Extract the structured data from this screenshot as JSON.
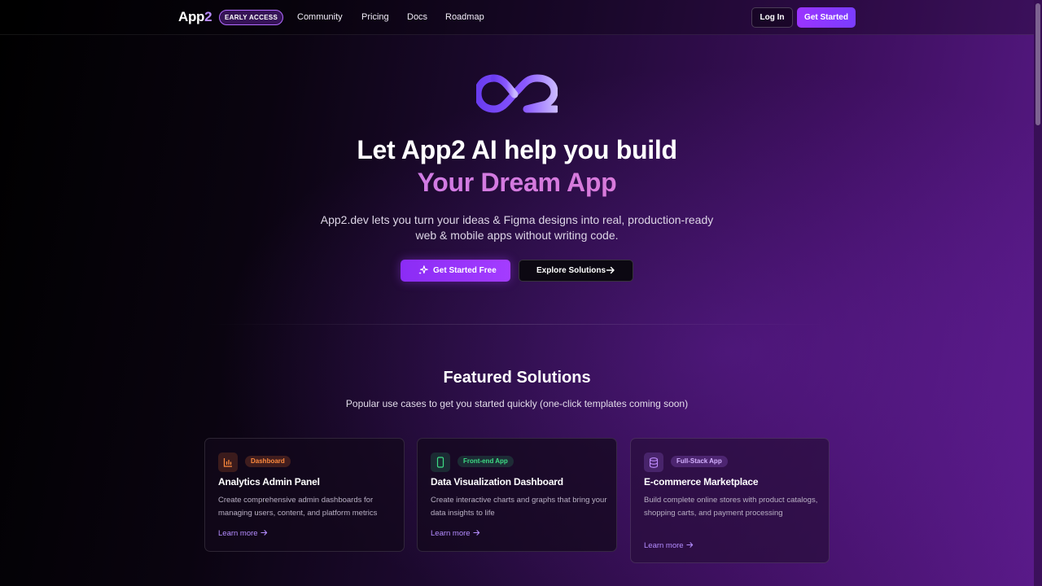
{
  "nav": {
    "brand_a": "App",
    "brand_b": "2",
    "badge": "EARLY ACCESS",
    "links": [
      "Community",
      "Pricing",
      "Docs",
      "Roadmap"
    ],
    "login": "Log In",
    "get_started": "Get Started"
  },
  "hero": {
    "title_line1": "Let App2 AI help you build",
    "title_line2": "Your Dream App",
    "sub_line1": "App2.dev lets you turn your ideas & Figma designs into real, production-ready",
    "sub_line2": "web & mobile apps without writing code.",
    "primary_cta": "Get Started Free",
    "secondary_cta": "Explore Solutions"
  },
  "featured": {
    "title": "Featured Solutions",
    "subtitle": "Popular use cases to get you started quickly (one-click templates coming soon)",
    "cards": [
      {
        "icon": "bar-chart-icon",
        "tag": "Dashboard",
        "tag_color": "#ff8a3d",
        "title": "Analytics Admin Panel",
        "desc": "Create comprehensive admin dashboards for managing users, content, and platform metrics",
        "link": "Learn more"
      },
      {
        "icon": "mobile-phone-icon",
        "tag": "Front-end App",
        "tag_color": "#3ddc84",
        "title": "Data Visualization Dashboard",
        "desc": "Create interactive charts and graphs that bring your data insights to life",
        "link": "Learn more"
      },
      {
        "icon": "database-icon",
        "tag": "Full-Stack App",
        "tag_color": "#c08cff",
        "title": "E-commerce Marketplace",
        "desc": "Build complete online stores with product catalogs, shopping carts, and payment processing",
        "link": "Learn more"
      }
    ]
  },
  "colors": {
    "accent": "#9b34ff",
    "gradient_text_start": "#c07cf5",
    "gradient_text_end": "#e879c9"
  }
}
